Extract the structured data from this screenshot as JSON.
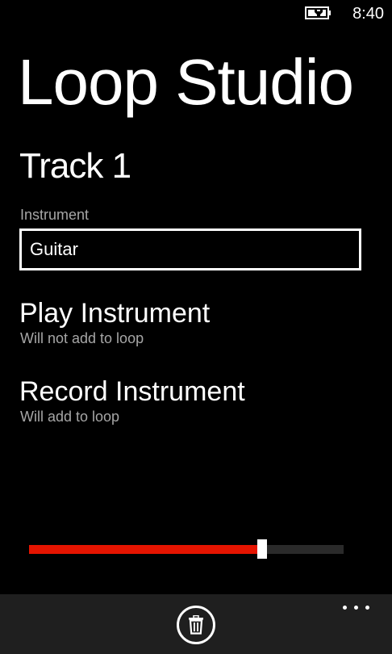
{
  "status_bar": {
    "time": "8:40",
    "battery_icon": "battery-charging-icon"
  },
  "app": {
    "title": "Loop Studio"
  },
  "page": {
    "title": "Track 1"
  },
  "instrument_field": {
    "label": "Instrument",
    "value": "Guitar"
  },
  "menu": {
    "play": {
      "title": "Play Instrument",
      "subtitle": "Will not add to loop"
    },
    "record": {
      "title": "Record Instrument",
      "subtitle": "Will add to loop"
    }
  },
  "slider": {
    "value_percent": 74,
    "fill_color": "#e51400",
    "track_color": "#2a2a2a",
    "thumb_color": "#ffffff"
  },
  "app_bar": {
    "background": "#1f1f1f",
    "delete_icon": "trash-icon",
    "more_icon": "ellipsis-icon"
  }
}
